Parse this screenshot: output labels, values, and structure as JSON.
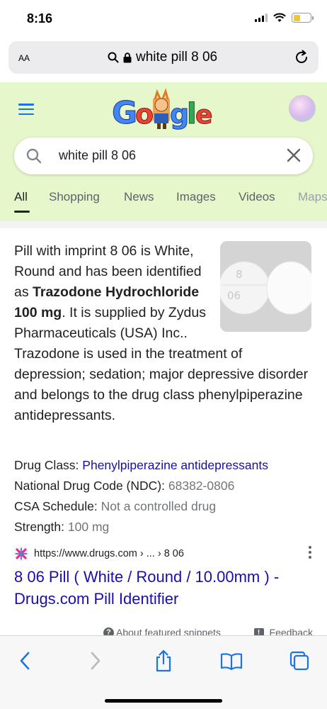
{
  "status_bar": {
    "time": "8:16",
    "battery_level": 0.4
  },
  "address_bar": {
    "aa_label": "AA",
    "url": "white pill 8 06"
  },
  "google": {
    "search_value": "white pill 8 06",
    "tabs": [
      {
        "label": "All",
        "active": true
      },
      {
        "label": "Shopping",
        "active": false
      },
      {
        "label": "News",
        "active": false
      },
      {
        "label": "Images",
        "active": false
      },
      {
        "label": "Videos",
        "active": false
      },
      {
        "label": "Maps",
        "active": false
      }
    ],
    "accent_color": "#1a73e8",
    "header_bg": "#e6f7cc"
  },
  "snippet": {
    "desc_1": "Pill with imprint 8 06 is White, Round and has been identified as ",
    "desc_bold_1": "Trazodone Hydrochloride 100 mg",
    "desc_2": ". It is supplied by Zydus Pharmaceuticals (USA) Inc.. Trazodone is used in the treatment of depression; sedation; major depressive disorder and belongs to the drug class phenylpiperazine antidepressants.",
    "pill_imprint_line_1": "8",
    "pill_imprint_line_2": "06",
    "facts": [
      {
        "label": "Drug Class:",
        "value": "Phenylpiperazine antidepressants",
        "style": "link"
      },
      {
        "label": "National Drug Code (NDC):",
        "value": "68382-0806",
        "style": "muted"
      },
      {
        "label": "CSA Schedule:",
        "value": "Not a controlled drug",
        "style": "muted"
      },
      {
        "label": "Strength:",
        "value": "100 mg",
        "style": "muted"
      }
    ],
    "source_url": "https://www.drugs.com › ... › 8 06",
    "result_title": "8 06 Pill ( White / Round / 10.00mm ) - Drugs.com Pill Identifier",
    "about_label": "About featured snippets",
    "feedback_label": "Feedback"
  }
}
